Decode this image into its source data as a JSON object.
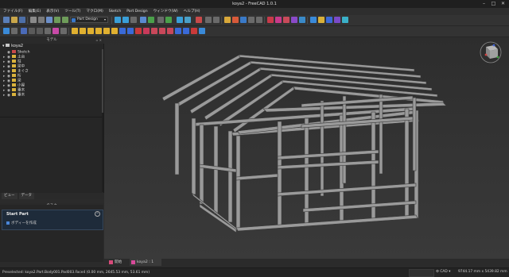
{
  "window": {
    "title": "koya2 - FreeCAD 1.0.1"
  },
  "menu": [
    "ファイル(F)",
    "編集(E)",
    "表示(V)",
    "ツール(T)",
    "マクロ(M)",
    "Sketch",
    "Part Design",
    "ウィンドウ(W)",
    "ヘルプ(H)"
  ],
  "toolbar": {
    "workbench": "Part Design"
  },
  "tree": {
    "header": "モデル",
    "root": "koya2",
    "items": [
      {
        "label": "Sketch",
        "type": "sketch",
        "expand": ""
      },
      {
        "label": "土台",
        "type": "folder",
        "expand": "▸"
      },
      {
        "label": "柱",
        "type": "folder",
        "expand": "▸"
      },
      {
        "label": "梁中",
        "type": "folder",
        "expand": "▸"
      },
      {
        "label": "まぐさ",
        "type": "folder",
        "expand": "▸"
      },
      {
        "label": "桁",
        "type": "folder",
        "expand": "▸"
      },
      {
        "label": "梁",
        "type": "folder",
        "expand": "▸"
      },
      {
        "label": "小屋",
        "type": "folder",
        "expand": "▸"
      },
      {
        "label": "垂木",
        "type": "folder",
        "expand": "▸"
      },
      {
        "label": "垂木",
        "type": "folder",
        "expand": "▸"
      }
    ]
  },
  "tabs": [
    "ビュー",
    "データ"
  ],
  "task": {
    "header": "タスク",
    "section_title": "Start Part",
    "action": "ボディーを作成"
  },
  "doc_tabs": [
    "開始",
    "koya2 : 1"
  ],
  "statusbar": {
    "message": "Preselected: koya2.Part.Body001.Pad003.Face4 (0.00 mm, 2645.53 mm, 53.61 mm)",
    "cad": "CAD",
    "dimensions": "9744.17 mm x 5439.82 mm"
  },
  "colors": {
    "accent": "#3a78c9",
    "beam": "#9a9a9a",
    "background": "#2b2b2b"
  }
}
